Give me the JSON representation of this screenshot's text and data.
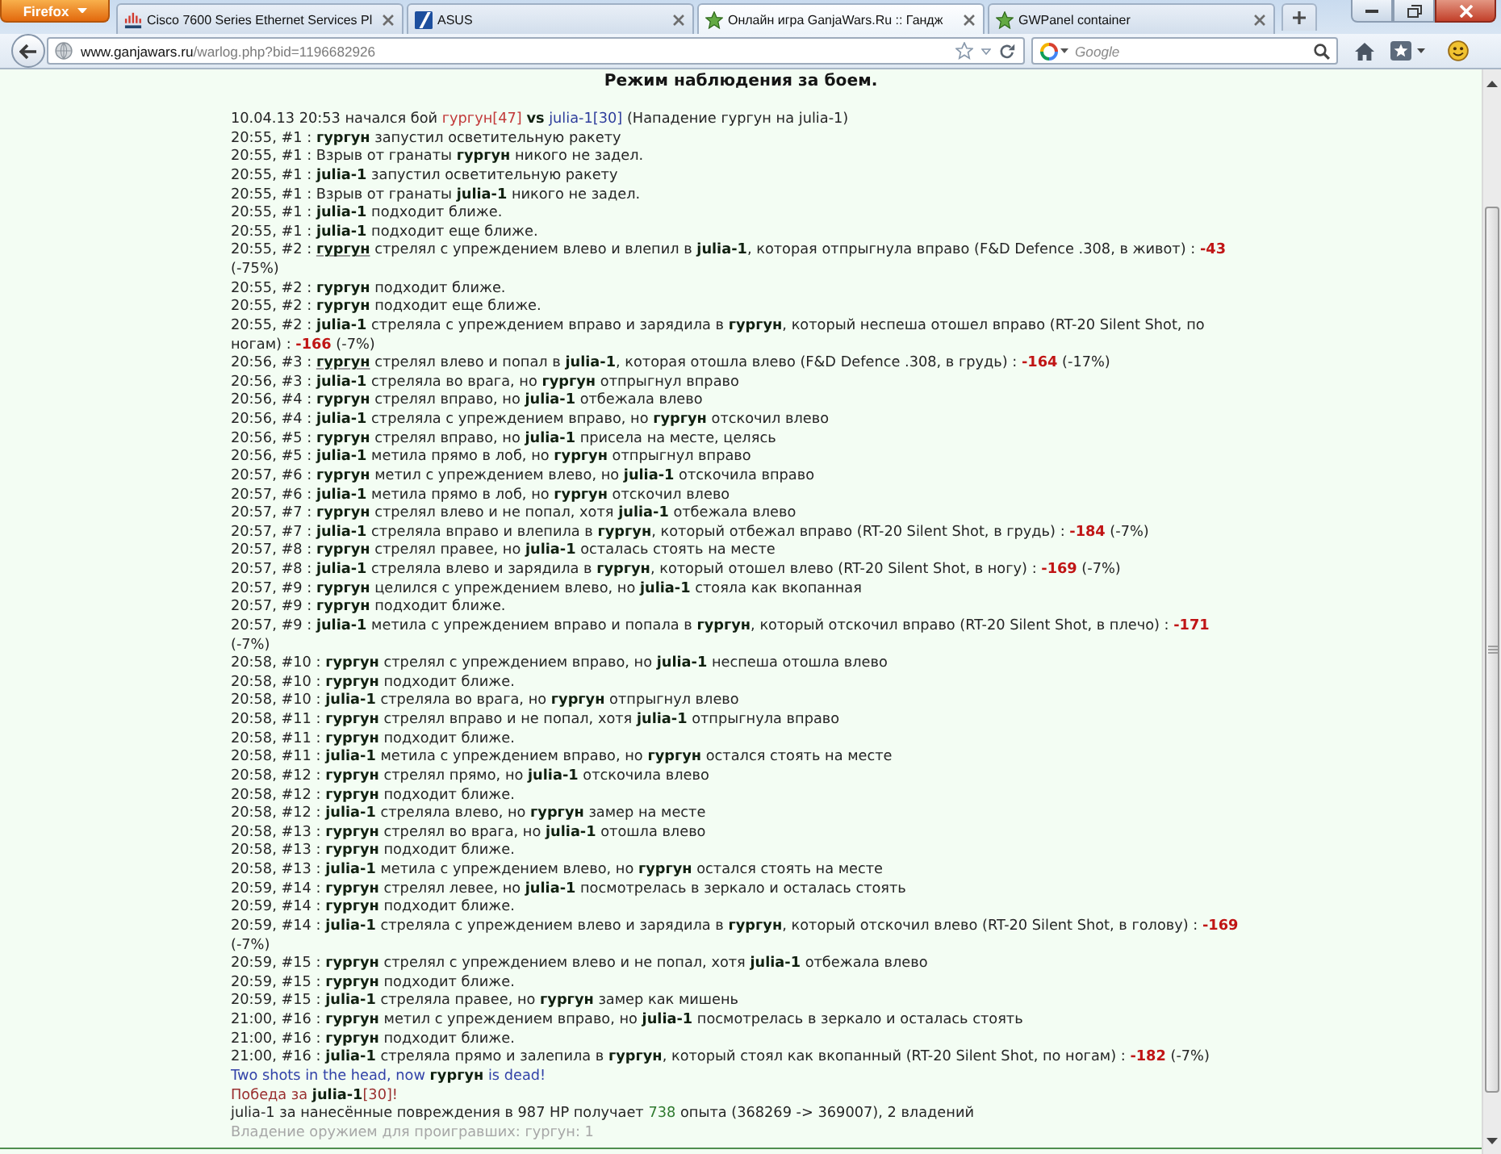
{
  "browser": {
    "app_button": "Firefox",
    "tabs": [
      {
        "title": "Cisco 7600 Series Ethernet Services Pl",
        "selected": false
      },
      {
        "title": "ASUS",
        "selected": false
      },
      {
        "title": "Онлайн игра GanjaWars.Ru :: Гандж",
        "selected": true
      },
      {
        "title": "GWPanel container",
        "selected": false
      }
    ],
    "url": {
      "host": "www.ganjawars.ru",
      "path": "/warlog.php?bid=1196682926"
    },
    "search": {
      "placeholder": "Google"
    }
  },
  "page": {
    "title": "Режим наблюдения за боем.",
    "start": {
      "started": "10.04.13 20:53 начался бой",
      "attacker": "гургун[47]",
      "versus": "vs",
      "defender": "julia-1[30]",
      "attack_note": "(Нападение гургун на julia-1)"
    },
    "log": [
      {
        "text": "20:55, #1 : **гургун** запустил осветительную ракету",
        "underlined": false
      },
      {
        "text": "20:55, #1 : Взрыв от гранаты **гургун** никого не задел.",
        "underlined": false
      },
      {
        "text": "20:55, #1 : **julia-1** запустил осветительную ракету",
        "underlined": false
      },
      {
        "text": "20:55, #1 : Взрыв от гранаты **julia-1** никого не задел.",
        "underlined": false
      },
      {
        "text": "20:55, #1 : **julia-1** подходит ближе.",
        "underlined": false
      },
      {
        "text": "20:55, #1 : **julia-1** подходит еще ближе.",
        "underlined": false
      },
      {
        "text": "20:55, #2 : **гургун** стрелял с упреждением влево и влепил в **julia-1**, которая отпрыгнула вправо (F&D Defence .308, в живот) :",
        "damage": "-43",
        "share": "(-75%)",
        "underlined": true
      },
      {
        "text": "20:55, #2 : **гургун** подходит ближе.",
        "underlined": false
      },
      {
        "text": "20:55, #2 : **гургун** подходит еще ближе.",
        "underlined": false
      },
      {
        "text": "20:55, #2 : **julia-1** стреляла с упреждением вправо и зарядила в **гургун**, который неспеша отошел вправо (RT-20 Silent Shot, по ногам) :",
        "damage": "-166",
        "share": "(-7%)",
        "underlined": false
      },
      {
        "text": "20:56, #3 : **гургун** стрелял влево и попал в **julia-1**, которая отошла влево (F&D Defence .308, в грудь) :",
        "damage": "-164",
        "share": "(-17%)",
        "underlined": true
      },
      {
        "text": "20:56, #3 : **julia-1** стреляла во врага, но **гургун** отпрыгнул вправо",
        "underlined": false
      },
      {
        "text": "20:56, #4 : **гургун** стрелял вправо, но **julia-1** отбежала влево",
        "underlined": false
      },
      {
        "text": "20:56, #4 : **julia-1** стреляла с упреждением вправо, но **гургун** отскочил влево",
        "underlined": false
      },
      {
        "text": "20:56, #5 : **гургун** стрелял вправо, но **julia-1** присела на месте, целясь",
        "underlined": false
      },
      {
        "text": "20:56, #5 : **julia-1** метила прямо в лоб, но **гургун** отпрыгнул вправо",
        "underlined": false
      },
      {
        "text": "20:57, #6 : **гургун** метил с упреждением влево, но **julia-1** отскочила вправо",
        "underlined": false
      },
      {
        "text": "20:57, #6 : **julia-1** метила прямо в лоб, но **гургун** отскочил влево",
        "underlined": false
      },
      {
        "text": "20:57, #7 : **гургун** стрелял влево и не попал, хотя **julia-1** отбежала влево",
        "underlined": false
      },
      {
        "text": "20:57, #7 : **julia-1** стреляла вправо и влепила в **гургун**, который отбежал вправо (RT-20 Silent Shot, в грудь) :",
        "damage": "-184",
        "share": "(-7%)",
        "underlined": false
      },
      {
        "text": "20:57, #8 : **гургун** стрелял правее, но **julia-1** осталась стоять на месте",
        "underlined": false
      },
      {
        "text": "20:57, #8 : **julia-1** стреляла влево и зарядила в **гургун**, который отошел влево (RT-20 Silent Shot, в ногу) :",
        "damage": "-169",
        "share": "(-7%)",
        "underlined": false
      },
      {
        "text": "20:57, #9 : **гургун** целился с упреждением влево, но **julia-1** стояла как вкопанная",
        "underlined": false
      },
      {
        "text": "20:57, #9 : **гургун** подходит ближе.",
        "underlined": false
      },
      {
        "text": "20:57, #9 : **julia-1** метила с упреждением вправо и попала в **гургун**, который отскочил вправо (RT-20 Silent Shot, в плечо) :",
        "damage": "-171",
        "share": "(-7%)",
        "underlined": false
      },
      {
        "text": "20:58, #10 : **гургун** стрелял с упреждением вправо, но **julia-1** неспеша отошла влево",
        "underlined": false
      },
      {
        "text": "20:58, #10 : **гургун** подходит ближе.",
        "underlined": false
      },
      {
        "text": "20:58, #10 : **julia-1** стреляла во врага, но **гургун** отпрыгнул влево",
        "underlined": false
      },
      {
        "text": "20:58, #11 : **гургун** стрелял вправо и не попал, хотя **julia-1** отпрыгнула вправо",
        "underlined": false
      },
      {
        "text": "20:58, #11 : **гургун** подходит ближе.",
        "underlined": false
      },
      {
        "text": "20:58, #11 : **julia-1** метила с упреждением вправо, но **гургун** остался стоять на месте",
        "underlined": false
      },
      {
        "text": "20:58, #12 : **гургун** стрелял прямо, но **julia-1** отскочила влево",
        "underlined": false
      },
      {
        "text": "20:58, #12 : **гургун** подходит ближе.",
        "underlined": false
      },
      {
        "text": "20:58, #12 : **julia-1** стреляла влево, но **гургун** замер на месте",
        "underlined": false
      },
      {
        "text": "20:58, #13 : **гургун** стрелял во врага, но **julia-1** отошла влево",
        "underlined": false
      },
      {
        "text": "20:58, #13 : **гургун** подходит ближе.",
        "underlined": false
      },
      {
        "text": "20:58, #13 : **julia-1** метила с упреждением влево, но **гургун** остался стоять на месте",
        "underlined": false
      },
      {
        "text": "20:59, #14 : **гургун** стрелял левее, но **julia-1** посмотрелась в зеркало и осталась стоять",
        "underlined": false
      },
      {
        "text": "20:59, #14 : **гургун** подходит ближе.",
        "underlined": false
      },
      {
        "text": "20:59, #14 : **julia-1** стреляла с упреждением влево и зарядила в **гургун**, который отскочил влево (RT-20 Silent Shot, в голову) :",
        "damage": "-169",
        "share": "(-7%)",
        "underlined": false
      },
      {
        "text": "20:59, #15 : **гургун** стрелял с упреждением влево и не попал, хотя **julia-1** отбежала влево",
        "underlined": false
      },
      {
        "text": "20:59, #15 : **гургун** подходит ближе.",
        "underlined": false
      },
      {
        "text": "20:59, #15 : **julia-1** стреляла правее, но **гургун** замер как мишень",
        "underlined": false
      },
      {
        "text": "21:00, #16 : **гургун** метил с упреждением вправо, но **julia-1** посмотрелась в зеркало и осталась стоять",
        "underlined": false
      },
      {
        "text": "21:00, #16 : **гургун** подходит ближе.",
        "underlined": false
      },
      {
        "text": "21:00, #16 : **julia-1** стреляла прямо и залепила в **гургун**, который стоял как вкопанный (RT-20 Silent Shot, по ногам) :",
        "damage": "-182",
        "share": "(-7%)",
        "underlined": false
      }
    ],
    "death_message": "Two shots in the head, now **гургун** is dead!",
    "victory": "Победа за **julia-1**[30]!",
    "experience": {
      "before": "julia-1 за нанесённые повреждения в 987 HP получает",
      "points": "738",
      "after": "опыта (368269 -> 369007), 2 владений"
    },
    "loser_note": "Владение оружием для проигравших: гургун: 1"
  }
}
